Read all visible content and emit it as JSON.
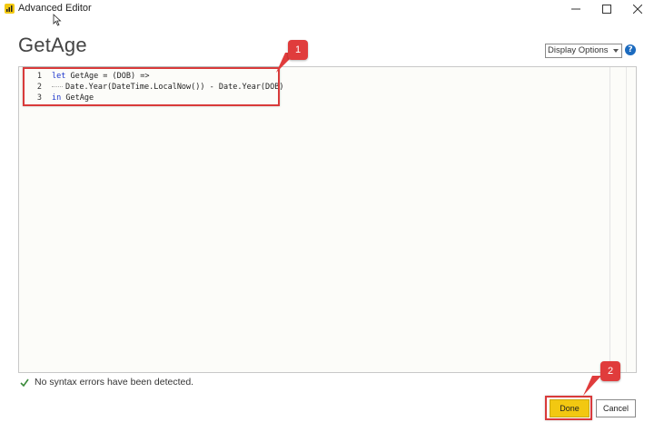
{
  "window": {
    "title": "Advanced Editor",
    "minimize_icon": "minimize-icon",
    "maximize_icon": "maximize-icon",
    "close_icon": "close-icon"
  },
  "header": {
    "page_title": "GetAge",
    "display_options_label": "Display Options",
    "help_label": "?"
  },
  "editor": {
    "lines": [
      {
        "number": "1",
        "keyword": "let",
        "rest": " GetAge = (DOB) =>"
      },
      {
        "number": "2",
        "keyword": "",
        "rest": "Date.Year(DateTime.LocalNow()) - Date.Year(DOB)"
      },
      {
        "number": "3",
        "keyword": "in",
        "rest": " GetAge"
      }
    ]
  },
  "annotations": {
    "callout_1": "1",
    "callout_2": "2",
    "callout_color": "#e03c3c"
  },
  "status": {
    "message": "No syntax errors have been detected."
  },
  "footer": {
    "done_label": "Done",
    "cancel_label": "Cancel"
  },
  "colors": {
    "accent": "#f2c811",
    "keyword": "#1a33cc",
    "help": "#1c6bbf",
    "success": "#3a8a3a"
  }
}
